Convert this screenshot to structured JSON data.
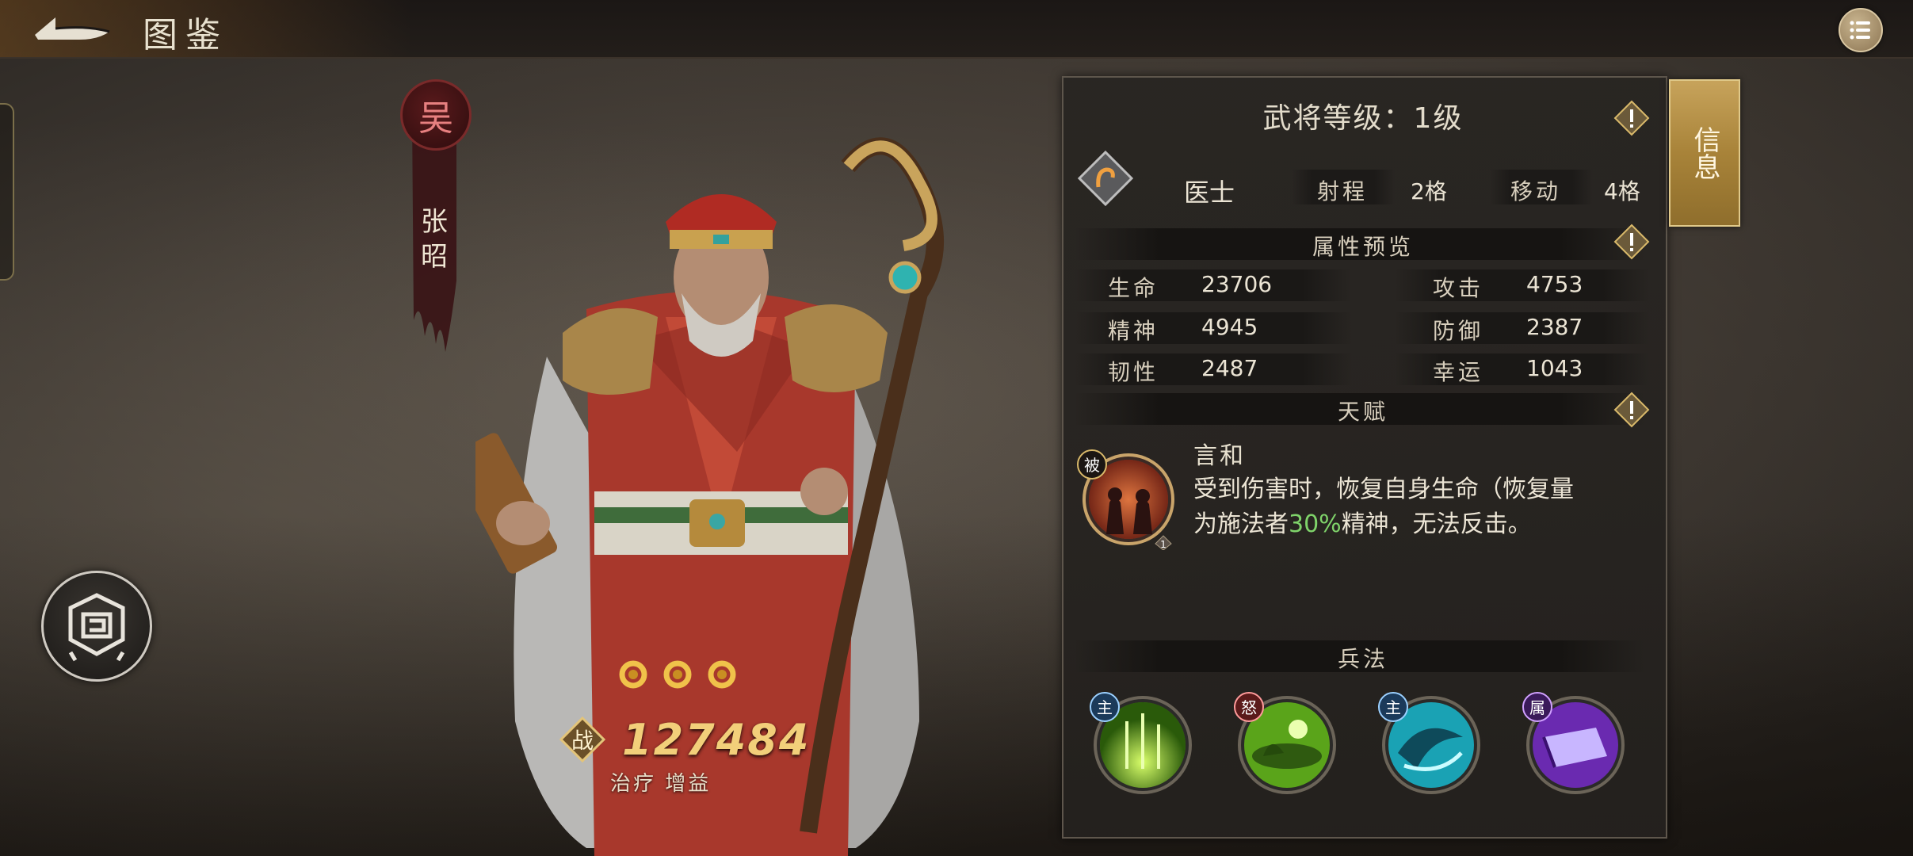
{
  "header": {
    "title": "图鉴"
  },
  "hero": {
    "faction": "吴",
    "name": "张昭",
    "stars": 3,
    "power_label": "战",
    "power": "127484",
    "role_tag": "治疗 增益"
  },
  "panel": {
    "level_text": "武将等级：1级",
    "class_name": "医士",
    "range_label": "射程",
    "range_value": "2格",
    "move_label": "移动",
    "move_value": "4格",
    "side_tab": "信息",
    "attr_title": "属性预览",
    "stats": [
      {
        "label": "生命",
        "value": "23706"
      },
      {
        "label": "攻击",
        "value": "4753"
      },
      {
        "label": "精神",
        "value": "4945"
      },
      {
        "label": "防御",
        "value": "2387"
      },
      {
        "label": "韧性",
        "value": "2487"
      },
      {
        "label": "幸运",
        "value": "1043"
      }
    ],
    "talent_title": "天赋",
    "talent": {
      "badge": "被",
      "level": "1",
      "name": "言和",
      "desc_1": "受到伤害时，恢复自身生命（恢复量",
      "desc_2a": "为施法者",
      "desc_2b": "30%",
      "desc_2c": "精神，无法反击。"
    },
    "skills_title": "兵法",
    "skills": [
      {
        "badge": "主",
        "icon": "green-runes-skill-icon"
      },
      {
        "badge": "怒",
        "icon": "green-orb-skill-icon"
      },
      {
        "badge": "主",
        "icon": "cyan-swirl-skill-icon"
      },
      {
        "badge": "属",
        "icon": "purple-book-skill-icon"
      }
    ]
  },
  "colors": {
    "gold": "#f2cf7a",
    "highlight_green": "#7fd36a",
    "tab_gold": "#a88339",
    "faction_red": "#e78080"
  }
}
